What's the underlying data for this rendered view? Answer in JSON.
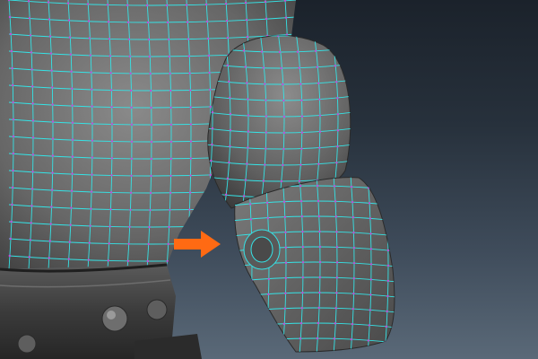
{
  "colors": {
    "background_top": "#1b222b",
    "background_bottom": "#5a6978",
    "mesh_fill": "#6b6b6b",
    "mesh_shadow": "#3a3a3a",
    "wire": "#35e3e6",
    "vertex": "#c04fd8",
    "arrow": "#ff6a13",
    "belt": "#3c3c3c"
  },
  "toolbar": {
    "icons": [
      {
        "name": "select-tool-icon",
        "color": "#8a8f96"
      },
      {
        "name": "move-tool-icon",
        "color": "#e3b34a"
      },
      {
        "name": "rotate-tool-icon",
        "color": "#e24a4a"
      },
      {
        "name": "scale-tool-icon",
        "color": "#c9c9c9"
      },
      {
        "name": "snap-tool-icon",
        "color": "#d0d0d0"
      },
      {
        "name": "lasso-tool-icon",
        "color": "#bdbdbd"
      }
    ]
  },
  "annotation": {
    "arrow_icon": "arrow-right-icon",
    "arrow_color": "#ff6a13",
    "points_to": "knee-joint-loop"
  }
}
